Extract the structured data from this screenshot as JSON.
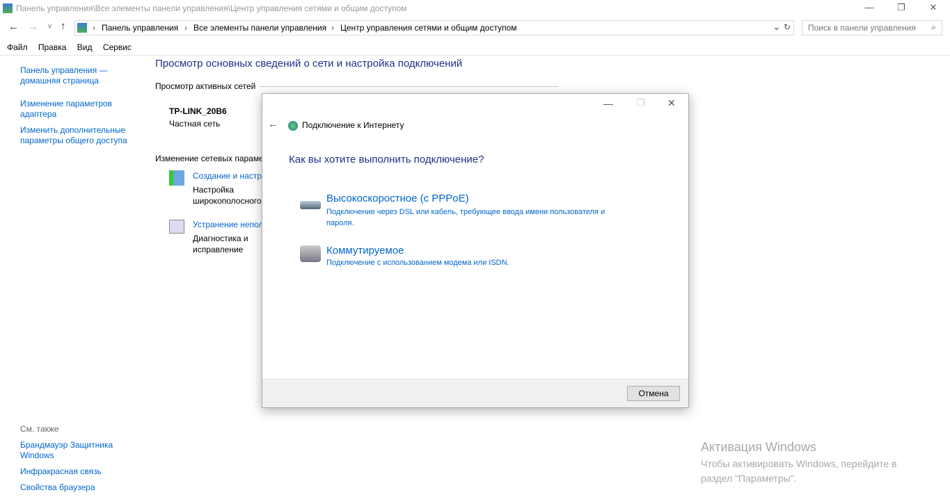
{
  "window": {
    "title": "Панель управления\\Все элементы панели управления\\Центр управления сетями и общим доступом",
    "minimize": "—",
    "maximize": "❐",
    "close": "✕"
  },
  "nav": {
    "back": "←",
    "forward": "→",
    "recent": "˅",
    "up": "↑",
    "breadcrumb": [
      "Панель управления",
      "Все элементы панели управления",
      "Центр управления сетями и общим доступом"
    ],
    "sep": "›",
    "dropdown": "⌄",
    "refresh": "↻",
    "search_placeholder": "Поиск в панели управления",
    "search_icon": "⌕"
  },
  "menu": [
    "Файл",
    "Правка",
    "Вид",
    "Сервис"
  ],
  "sidebar": {
    "links": [
      "Панель управления — домашняя страница",
      "Изменение параметров адаптера",
      "Изменить дополнительные параметры общего доступа"
    ],
    "see_also": "См. также",
    "see_also_links": [
      "Брандмауэр Защитника Windows",
      "Инфракрасная связь",
      "Свойства браузера"
    ]
  },
  "main": {
    "heading": "Просмотр основных сведений о сети и настройка подключений",
    "active_networks": "Просмотр активных сетей",
    "network_name": "TP-LINK_20B6",
    "network_type": "Частная сеть",
    "change_settings": "Изменение сетевых параметров",
    "tasks": [
      {
        "title": "Создание и настройка нового подключения или сети",
        "desc": "Настройка широкополосного, коммутируемого или VPN-подключения либо настройка маршрутизатора или точки доступа."
      },
      {
        "title": "Устранение неполадок",
        "desc": "Диагностика и исправление сетевых проблем или получение сведений об устранении неполадок."
      }
    ]
  },
  "dialog": {
    "title": "Подключение к Интернету",
    "question": "Как вы хотите выполнить подключение?",
    "options": [
      {
        "title": "Высокоскоростное (с PPPoE)",
        "desc": "Подключение через DSL или кабель, требующее ввода имени пользователя и пароля."
      },
      {
        "title": "Коммутируемое",
        "desc": "Подключение с использованием модема или ISDN."
      }
    ],
    "cancel": "Отмена"
  },
  "watermark": {
    "title": "Активация Windows",
    "text": "Чтобы активировать Windows, перейдите в раздел \"Параметры\"."
  }
}
